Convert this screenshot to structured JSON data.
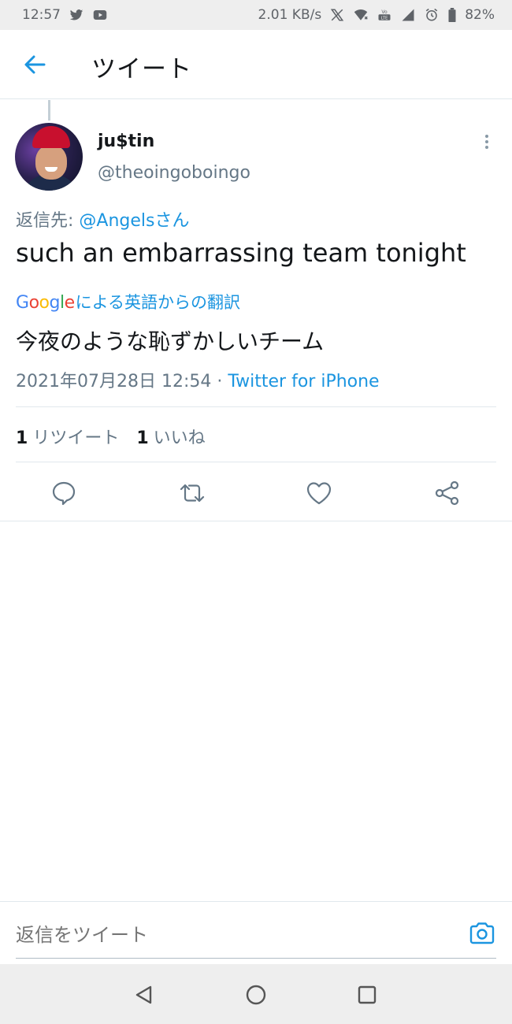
{
  "status_bar": {
    "time": "12:57",
    "speed": "2.01 KB/s",
    "battery": "82%",
    "icons": [
      "twitter-icon",
      "youtube-icon",
      "x-icon",
      "wifi-icon",
      "volte-icon",
      "signal-icon",
      "alarm-icon",
      "battery-icon"
    ]
  },
  "header": {
    "title": "ツイート",
    "back_icon": "arrow-left-icon"
  },
  "tweet": {
    "display_name": "ju$tin",
    "handle": "@theoingoboingo",
    "reply_prefix": "返信先: ",
    "reply_mention": "@Angelsさん",
    "text": "such an embarrassing team tonight",
    "translate_label": "による英語からの翻訳",
    "google_letters": [
      "G",
      "o",
      "o",
      "g",
      "l",
      "e"
    ],
    "translated_text": "今夜のような恥ずかしいチーム",
    "timestamp": "2021年07月28日 12:54 · ",
    "source": "Twitter for iPhone"
  },
  "stats": {
    "retweets_count": "1",
    "retweets_label": "リツイート",
    "likes_count": "1",
    "likes_label": "いいね"
  },
  "actions": [
    "reply-icon",
    "retweet-icon",
    "like-icon",
    "share-icon"
  ],
  "reply_bar": {
    "placeholder": "返信をツイート",
    "camera_icon": "camera-icon"
  },
  "nav": [
    "back-triangle-icon",
    "home-circle-icon",
    "recents-square-icon"
  ],
  "colors": {
    "accent": "#1b95e0",
    "text": "#14171a",
    "secondary": "#657786",
    "divider": "#e1e8ed"
  }
}
